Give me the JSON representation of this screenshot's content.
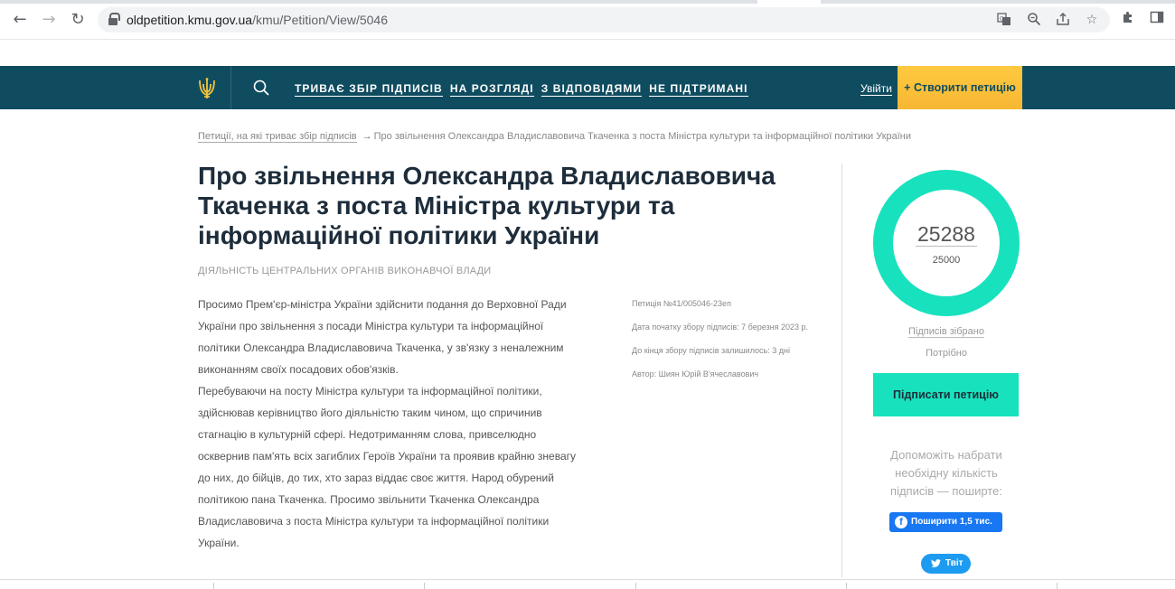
{
  "browser": {
    "url_host": "oldpetition.kmu.gov.ua",
    "url_path": "/kmu/Petition/View/5046",
    "icons": {
      "back": "arrow-left-icon",
      "forward": "arrow-right-icon",
      "reload": "reload-icon",
      "lock": "lock-icon",
      "translate": "translate-icon",
      "zoom": "zoom-icon",
      "share": "share-icon",
      "bookmark": "star-icon",
      "extensions": "puzzle-icon",
      "sidepanel": "side-panel-icon"
    }
  },
  "header": {
    "menu": [
      {
        "label": "ТРИВАЄ ЗБІР ПІДПИСІВ"
      },
      {
        "label": "НА РОЗГЛЯДІ"
      },
      {
        "label": "З ВІДПОВІДЯМИ"
      },
      {
        "label": "НЕ ПІДТРИМАНІ"
      }
    ],
    "login": "Увійти",
    "create": "+ Створити петицію",
    "colors": {
      "bar": "#0f4c60",
      "create": "#fdc03e"
    }
  },
  "breadcrumb": {
    "parent": "Петиції, на які триває збір підписів",
    "arrow": "→",
    "current": "Про звільнення Олександра Владиславовича Ткаченка з поста Міністра культури та інформаційної політики України"
  },
  "petition": {
    "title": "Про звільнення Олександра Владиславовича Ткаченка з поста Міністра культури та інформаційної політики України",
    "category": "ДІЯЛЬНІСТЬ ЦЕНТРАЛЬНИХ ОРГАНІВ ВИКОНАВЧОЇ ВЛАДИ",
    "body_lines": [
      "Просимо Прем'єр-міністра України здійснити подання до Верховної Ради",
      "України про звільнення з посади Міністра культури та інформаційної",
      "політики Олександра Владиславовича Ткаченка, у зв'язку з неналежним",
      "виконанням своїх посадових обов'язків.",
      "Перебуваючи на посту Міністра культури та інформаційної політики,",
      "здійснював керівництво його діяльністю таким чином, що спричинив",
      "стагнацію в культурній сфері. Недотриманням слова, привселюдно",
      "осквернив пам'ять всіх загиблих Героїв України та проявив крайню зневагу",
      "до них, до бійців, до тих, хто зараз віддає своє життя. Народ обурений",
      "політикою пана Ткаченка. Просимо звільнити Ткаченка Олександра",
      "Владиславовича з поста Міністра культури та інформаційної політики",
      "України."
    ],
    "meta": {
      "number": "Петиція №41/005046-23еп",
      "start_date": "Дата початку збору підписів: 7 березня 2023 р.",
      "remaining": "До кінця збору підписів залишилось: 3 дні",
      "author": "Автор: Шиян Юрій В'ячеславович"
    }
  },
  "signatures": {
    "collected": "25288",
    "needed": "25000",
    "progress_fraction": 1.0,
    "collected_label": "Підписів зібрано",
    "needed_label": "Потрібно",
    "sign_button": "Підписати петицію",
    "help_text": "Допоможіть набрати необхідну кількість підписів — поширте:",
    "facebook_share": "Поширити 1,5 тис.",
    "tweet": "Твіт",
    "colors": {
      "ring": "#17e2bd",
      "sign_button": "#17e2bd"
    }
  }
}
